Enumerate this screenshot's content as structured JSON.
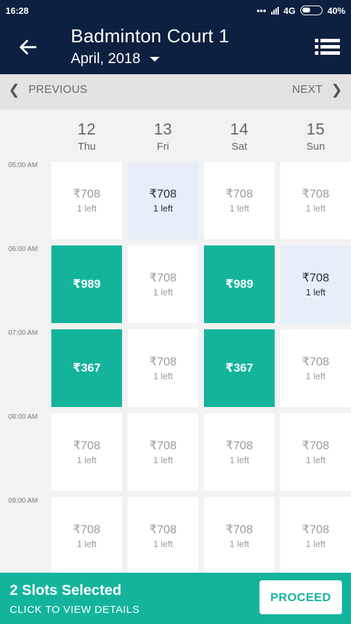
{
  "status_bar": {
    "time": "16:28",
    "dots": "•••",
    "network": "4G",
    "battery": "40%"
  },
  "app_bar": {
    "title": "Badminton Court 1",
    "month": "April, 2018"
  },
  "nav": {
    "previous": "PREVIOUS",
    "next": "NEXT"
  },
  "days": [
    {
      "num": "12",
      "name": "Thu"
    },
    {
      "num": "13",
      "name": "Fri"
    },
    {
      "num": "14",
      "name": "Sat"
    },
    {
      "num": "15",
      "name": "Sun"
    }
  ],
  "times": [
    "05:00 AM",
    "06:00 AM",
    "07:00 AM",
    "08:00 AM",
    "09:00 AM"
  ],
  "slots": [
    [
      {
        "price": "₹708",
        "left": "1 left",
        "state": "normal"
      },
      {
        "price": "₹708",
        "left": "1 left",
        "state": "highlight"
      },
      {
        "price": "₹708",
        "left": "1 left",
        "state": "normal"
      },
      {
        "price": "₹708",
        "left": "1 left",
        "state": "normal"
      }
    ],
    [
      {
        "price": "₹989",
        "left": "",
        "state": "selected"
      },
      {
        "price": "₹708",
        "left": "1 left",
        "state": "normal"
      },
      {
        "price": "₹989",
        "left": "",
        "state": "selected"
      },
      {
        "price": "₹708",
        "left": "1 left",
        "state": "highlight"
      }
    ],
    [
      {
        "price": "₹367",
        "left": "",
        "state": "selected"
      },
      {
        "price": "₹708",
        "left": "1 left",
        "state": "normal"
      },
      {
        "price": "₹367",
        "left": "",
        "state": "selected"
      },
      {
        "price": "₹708",
        "left": "1 left",
        "state": "normal"
      }
    ],
    [
      {
        "price": "₹708",
        "left": "1 left",
        "state": "normal"
      },
      {
        "price": "₹708",
        "left": "1 left",
        "state": "normal"
      },
      {
        "price": "₹708",
        "left": "1 left",
        "state": "normal"
      },
      {
        "price": "₹708",
        "left": "1 left",
        "state": "normal"
      }
    ],
    [
      {
        "price": "₹708",
        "left": "1 left",
        "state": "normal"
      },
      {
        "price": "₹708",
        "left": "1 left",
        "state": "normal"
      },
      {
        "price": "₹708",
        "left": "1 left",
        "state": "normal"
      },
      {
        "price": "₹708",
        "left": "1 left",
        "state": "normal"
      }
    ]
  ],
  "footer": {
    "count": "2 Slots Selected",
    "sub": "CLICK TO VIEW DETAILS",
    "proceed": "PROCEED"
  },
  "colors": {
    "appbar": "#0e2040",
    "accent": "#14b49c",
    "highlight": "#e8eef8"
  },
  "icons": [
    "back-arrow-icon",
    "dropdown-caret-icon",
    "menu-list-icon",
    "chevron-left-icon",
    "chevron-right-icon",
    "signal-icon",
    "battery-icon"
  ]
}
